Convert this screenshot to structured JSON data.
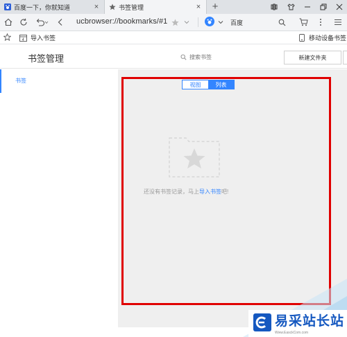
{
  "tabs": [
    {
      "title": "百度一下，你就知道",
      "close": "×",
      "icon": "baidu-paw-icon"
    },
    {
      "title": "书签管理",
      "close": "×",
      "icon": "star-icon",
      "active": true
    }
  ],
  "tab_new": "+",
  "address_bar": {
    "url": "ucbrowser://bookmarks/#1",
    "search_engine": "百度",
    "engine_color": "#3385ff"
  },
  "bookmark_bar": {
    "import_label": "导入书签",
    "mobile_label": "移动设备书签"
  },
  "header": {
    "title": "书签管理",
    "search_placeholder": "搜索书签",
    "new_folder_label": "新建文件夹"
  },
  "sidebar": {
    "items": [
      {
        "label": "书签",
        "active": true
      }
    ]
  },
  "view_toggle": {
    "view_label": "视图",
    "list_label": "列表",
    "selected": "列表"
  },
  "empty_state": {
    "text_before": "还没有书签记录，马上",
    "link": "导入书签",
    "text_after": "吧!"
  },
  "watermark": {
    "name": "易采站长站",
    "url": "Www.EasckCom.com"
  },
  "colors": {
    "accent": "#3385ff",
    "highlight_box": "#e00000"
  }
}
